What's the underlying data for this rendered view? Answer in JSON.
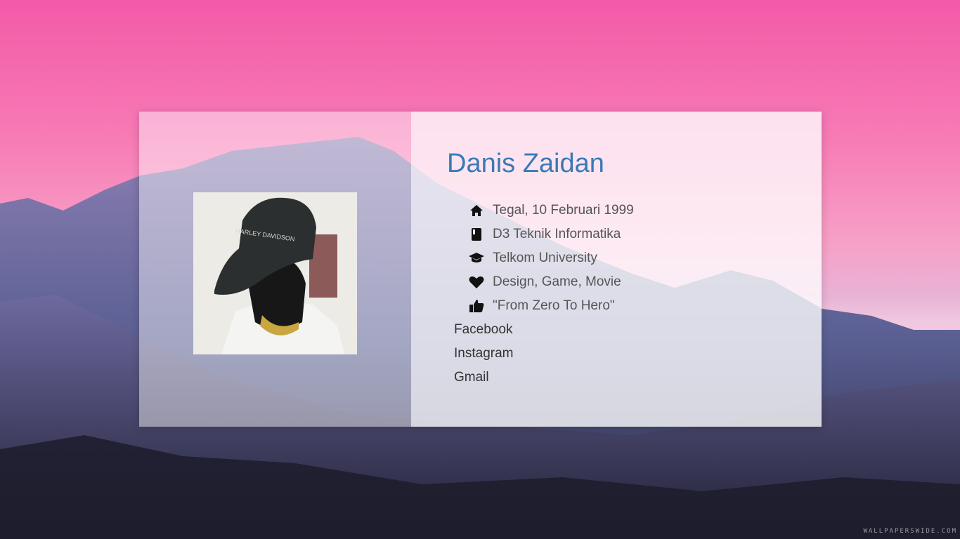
{
  "profile": {
    "name": "Danis Zaidan",
    "info": [
      {
        "icon": "home-icon",
        "text": "Tegal, 10 Februari 1999"
      },
      {
        "icon": "book-icon",
        "text": "D3 Teknik Informatika"
      },
      {
        "icon": "graduation-cap-icon",
        "text": "Telkom University"
      },
      {
        "icon": "heart-icon",
        "text": "Design, Game, Movie"
      },
      {
        "icon": "thumbs-up-icon",
        "text": "\"From Zero To Hero\""
      }
    ],
    "social": [
      {
        "label": "Facebook"
      },
      {
        "label": "Instagram"
      },
      {
        "label": "Gmail"
      }
    ]
  },
  "watermark": "WALLPAPERSWIDE.COM",
  "colors": {
    "name": "#3a7ab5",
    "sky_top": "#f35aa8",
    "sky_bottom": "#f0c9e0",
    "mountain": "#5a5f93"
  }
}
